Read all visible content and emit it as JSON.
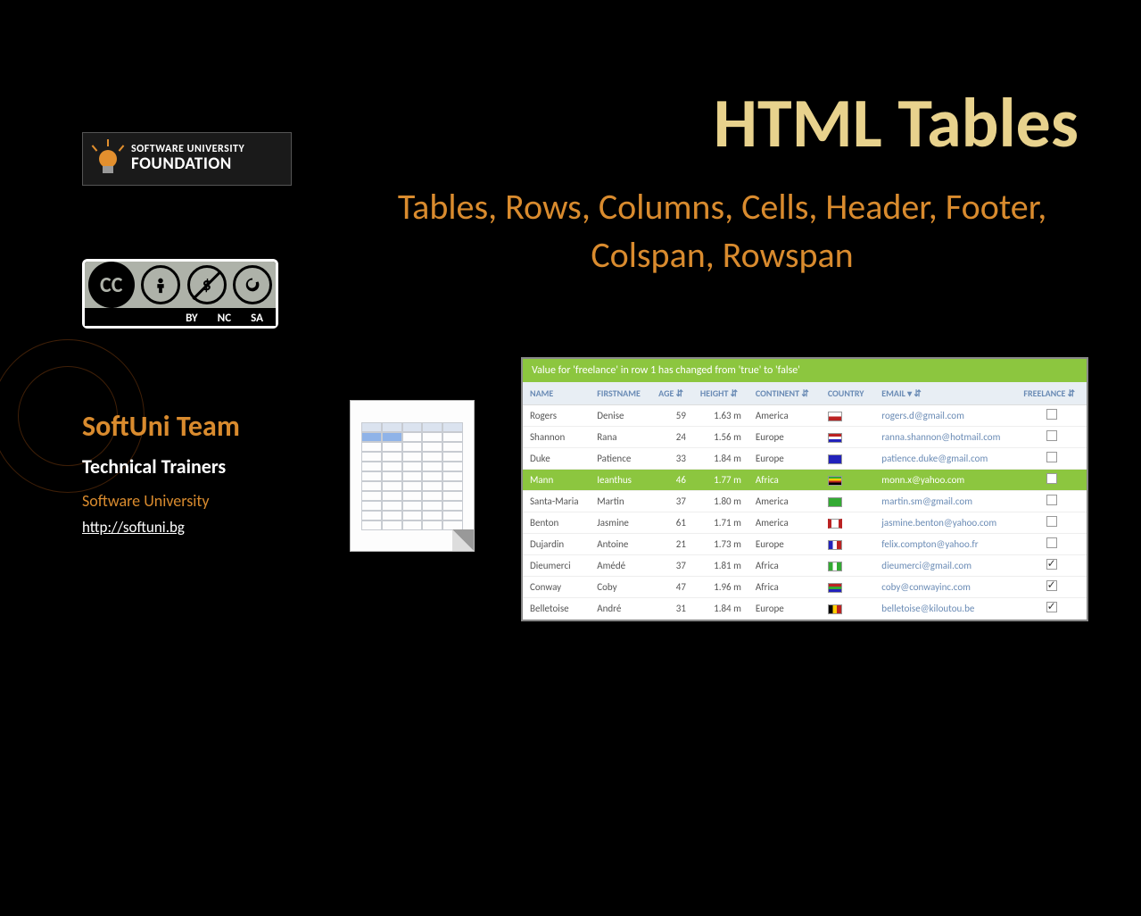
{
  "title": "HTML Tables",
  "subtitle": "Tables, Rows, Columns, Cells, Header, Footer, Colspan, Rowspan",
  "logo": {
    "top": "SOFTWARE UNIVERSITY",
    "bottom": "FOUNDATION"
  },
  "cc": {
    "labels": [
      "BY",
      "NC",
      "SA"
    ]
  },
  "credits": {
    "team": "SoftUni Team",
    "role": "Technical Trainers",
    "org": "Software University",
    "url": "http://softuni.bg"
  },
  "sample": {
    "notice": "Value for 'freelance' in row 1 has changed from 'true' to 'false'",
    "headers": [
      "NAME",
      "FIRSTNAME",
      "AGE ⇵",
      "HEIGHT ⇵",
      "CONTINENT ⇵",
      "COUNTRY",
      "EMAIL ▾ ⇵",
      "FREELANCE ⇵"
    ],
    "rows": [
      {
        "name": "Rogers",
        "first": "Denise",
        "age": "59",
        "height": "1.63 m",
        "cont": "America",
        "flag": "us",
        "email": "rogers.d@gmail.com",
        "free": false
      },
      {
        "name": "Shannon",
        "first": "Rana",
        "age": "24",
        "height": "1.56 m",
        "cont": "Europe",
        "flag": "nl",
        "email": "ranna.shannon@hotmail.com",
        "free": false
      },
      {
        "name": "Duke",
        "first": "Patience",
        "age": "33",
        "height": "1.84 m",
        "cont": "Europe",
        "flag": "uk",
        "email": "patience.duke@gmail.com",
        "free": false
      },
      {
        "name": "Mann",
        "first": "Ieanthus",
        "age": "46",
        "height": "1.77 m",
        "cont": "Africa",
        "flag": "zw",
        "email": "monn.x@yahoo.com",
        "free": false,
        "hl": true
      },
      {
        "name": "Santa-Maria",
        "first": "Martin",
        "age": "37",
        "height": "1.80 m",
        "cont": "America",
        "flag": "br",
        "email": "martin.sm@gmail.com",
        "free": false
      },
      {
        "name": "Benton",
        "first": "Jasmine",
        "age": "61",
        "height": "1.71 m",
        "cont": "America",
        "flag": "ca",
        "email": "jasmine.benton@yahoo.com",
        "free": false
      },
      {
        "name": "Dujardin",
        "first": "Antoine",
        "age": "21",
        "height": "1.73 m",
        "cont": "Europe",
        "flag": "fr",
        "email": "felix.compton@yahoo.fr",
        "free": false
      },
      {
        "name": "Dieumerci",
        "first": "Amédé",
        "age": "37",
        "height": "1.81 m",
        "cont": "Africa",
        "flag": "ng",
        "email": "dieumerci@gmail.com",
        "free": true
      },
      {
        "name": "Conway",
        "first": "Coby",
        "age": "47",
        "height": "1.96 m",
        "cont": "Africa",
        "flag": "za",
        "email": "coby@conwayinc.com",
        "free": true
      },
      {
        "name": "Belletoise",
        "first": "André",
        "age": "31",
        "height": "1.84 m",
        "cont": "Europe",
        "flag": "be",
        "email": "belletoise@kiloutou.be",
        "free": true
      }
    ]
  }
}
